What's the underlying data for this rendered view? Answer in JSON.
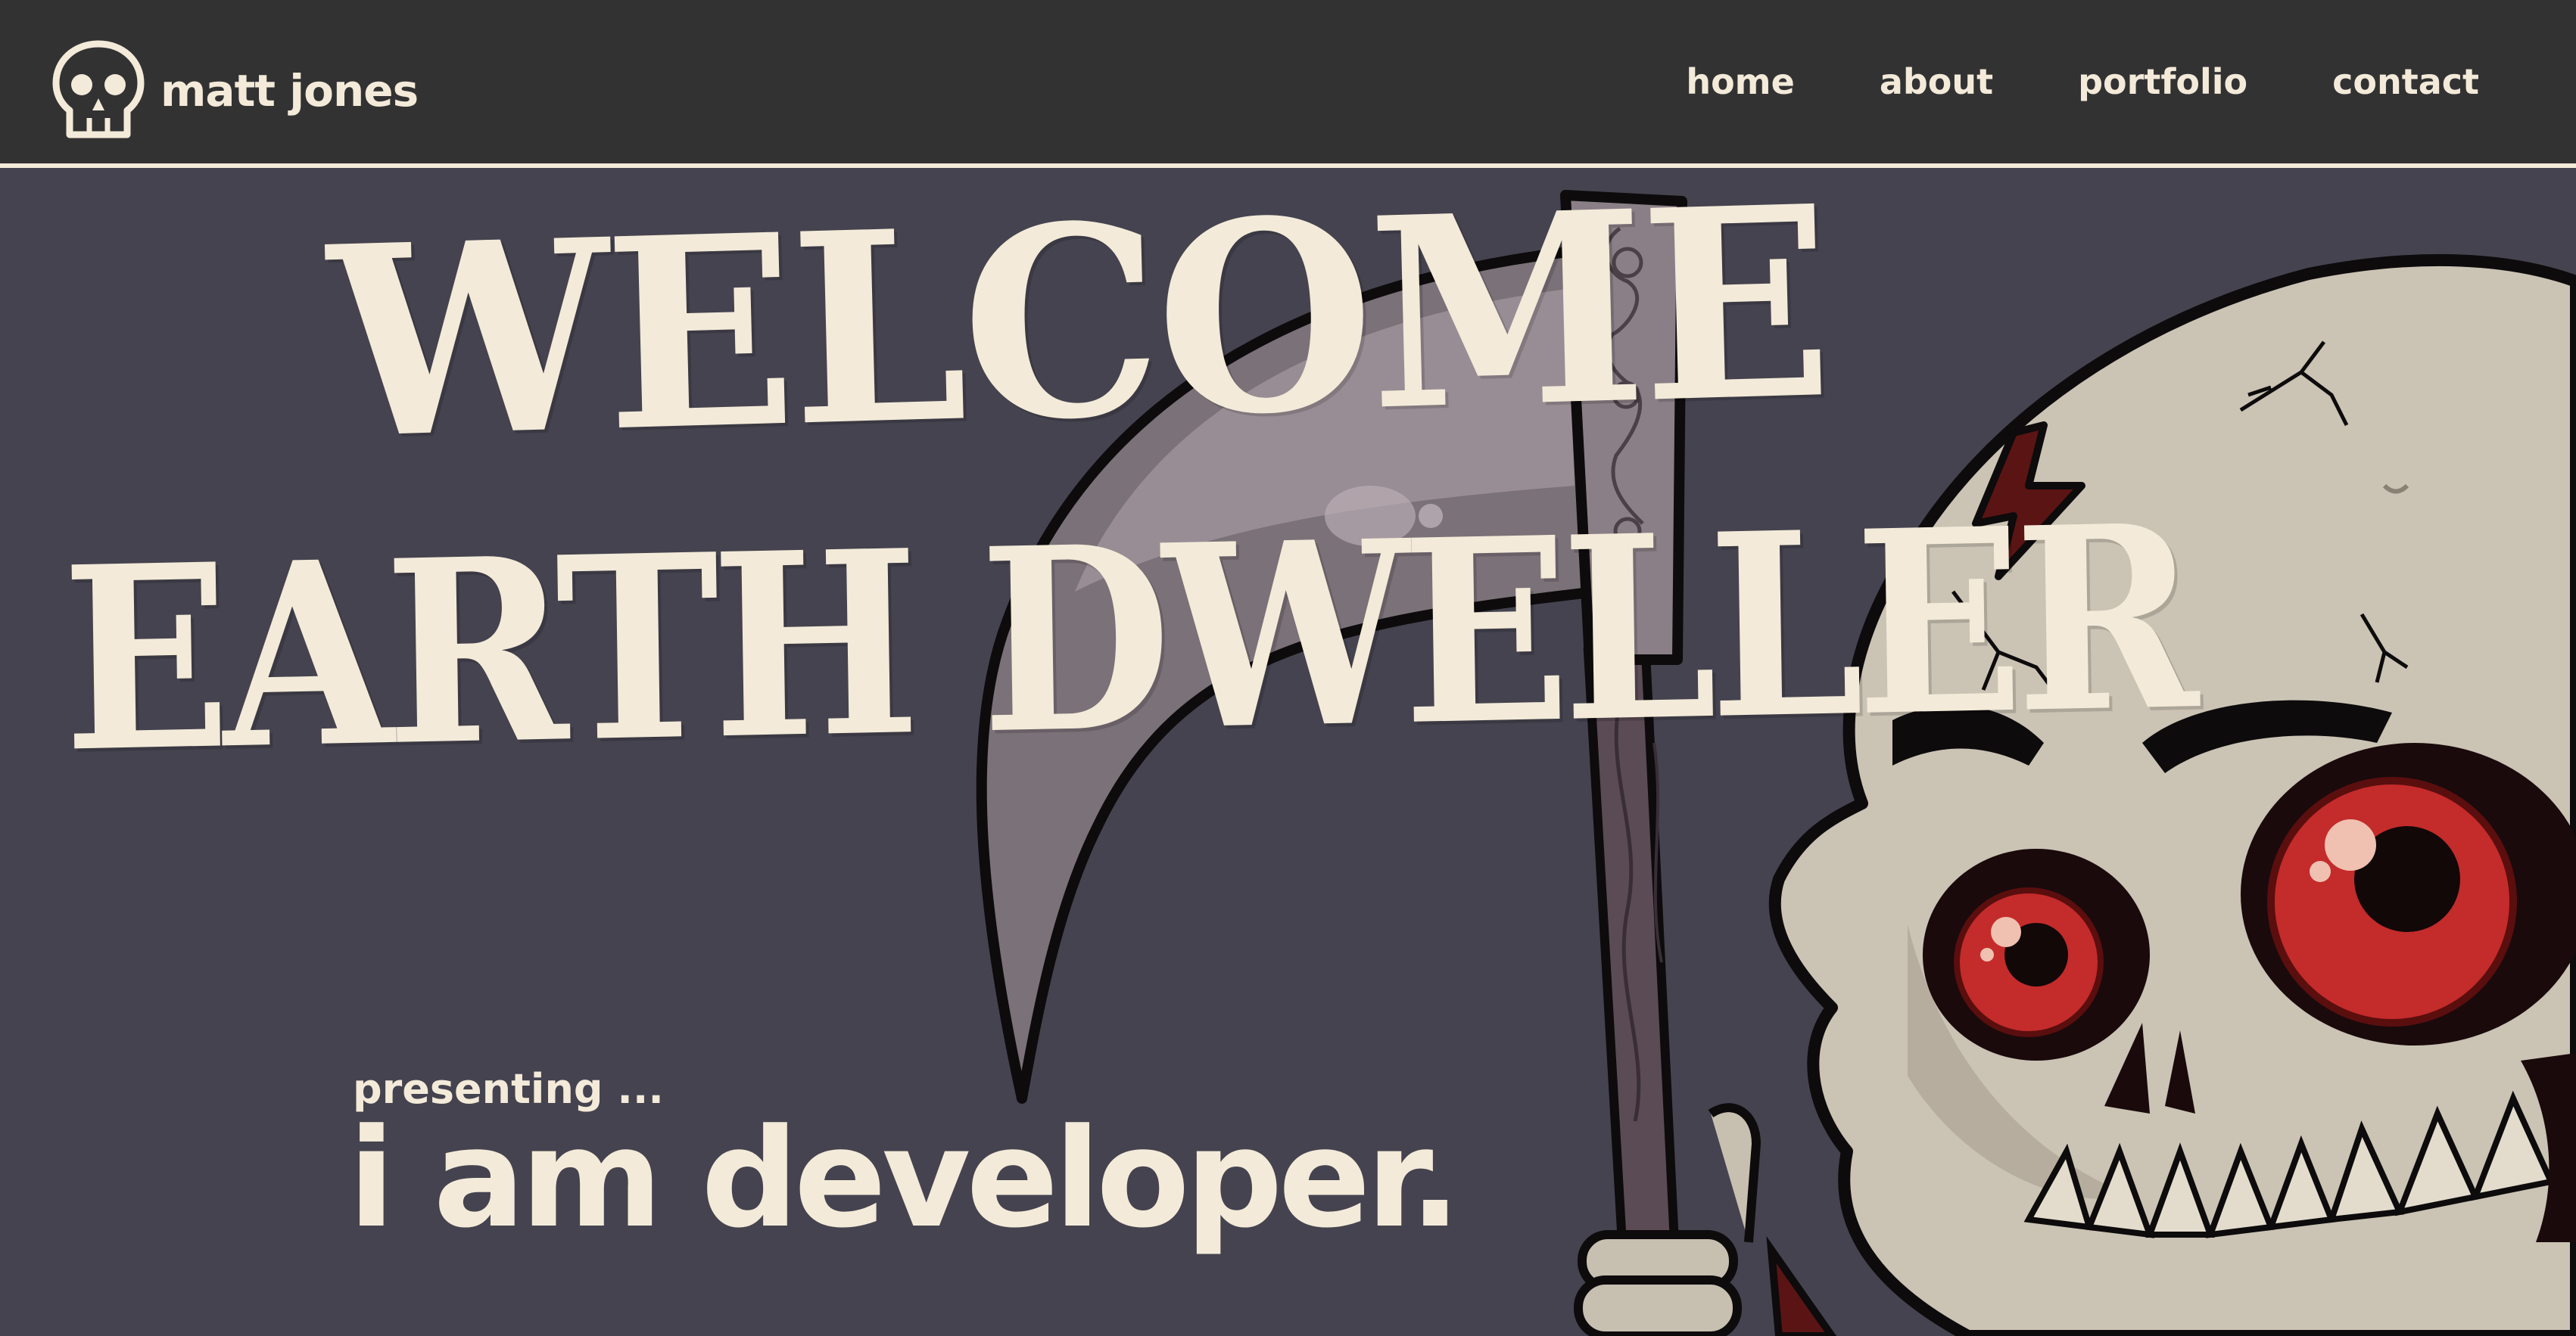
{
  "header": {
    "logo_icon": "skull-icon",
    "brand_name": "matt jones",
    "nav": [
      {
        "label": "home"
      },
      {
        "label": "about"
      },
      {
        "label": "portfolio"
      },
      {
        "label": "contact"
      }
    ]
  },
  "hero": {
    "welcome_line_1": "WELCOME",
    "welcome_line_2": "EARTH DWELLER",
    "presenting": "presenting ...",
    "headline": "i am developer.",
    "illustration": "grim-reaper-skull-with-scythe"
  },
  "colors": {
    "nav_background": "#333233",
    "hero_background": "#45434f",
    "cream_text": "#f3ead9",
    "eye_red": "#c42b2b",
    "bone": "#cbc3b4"
  }
}
